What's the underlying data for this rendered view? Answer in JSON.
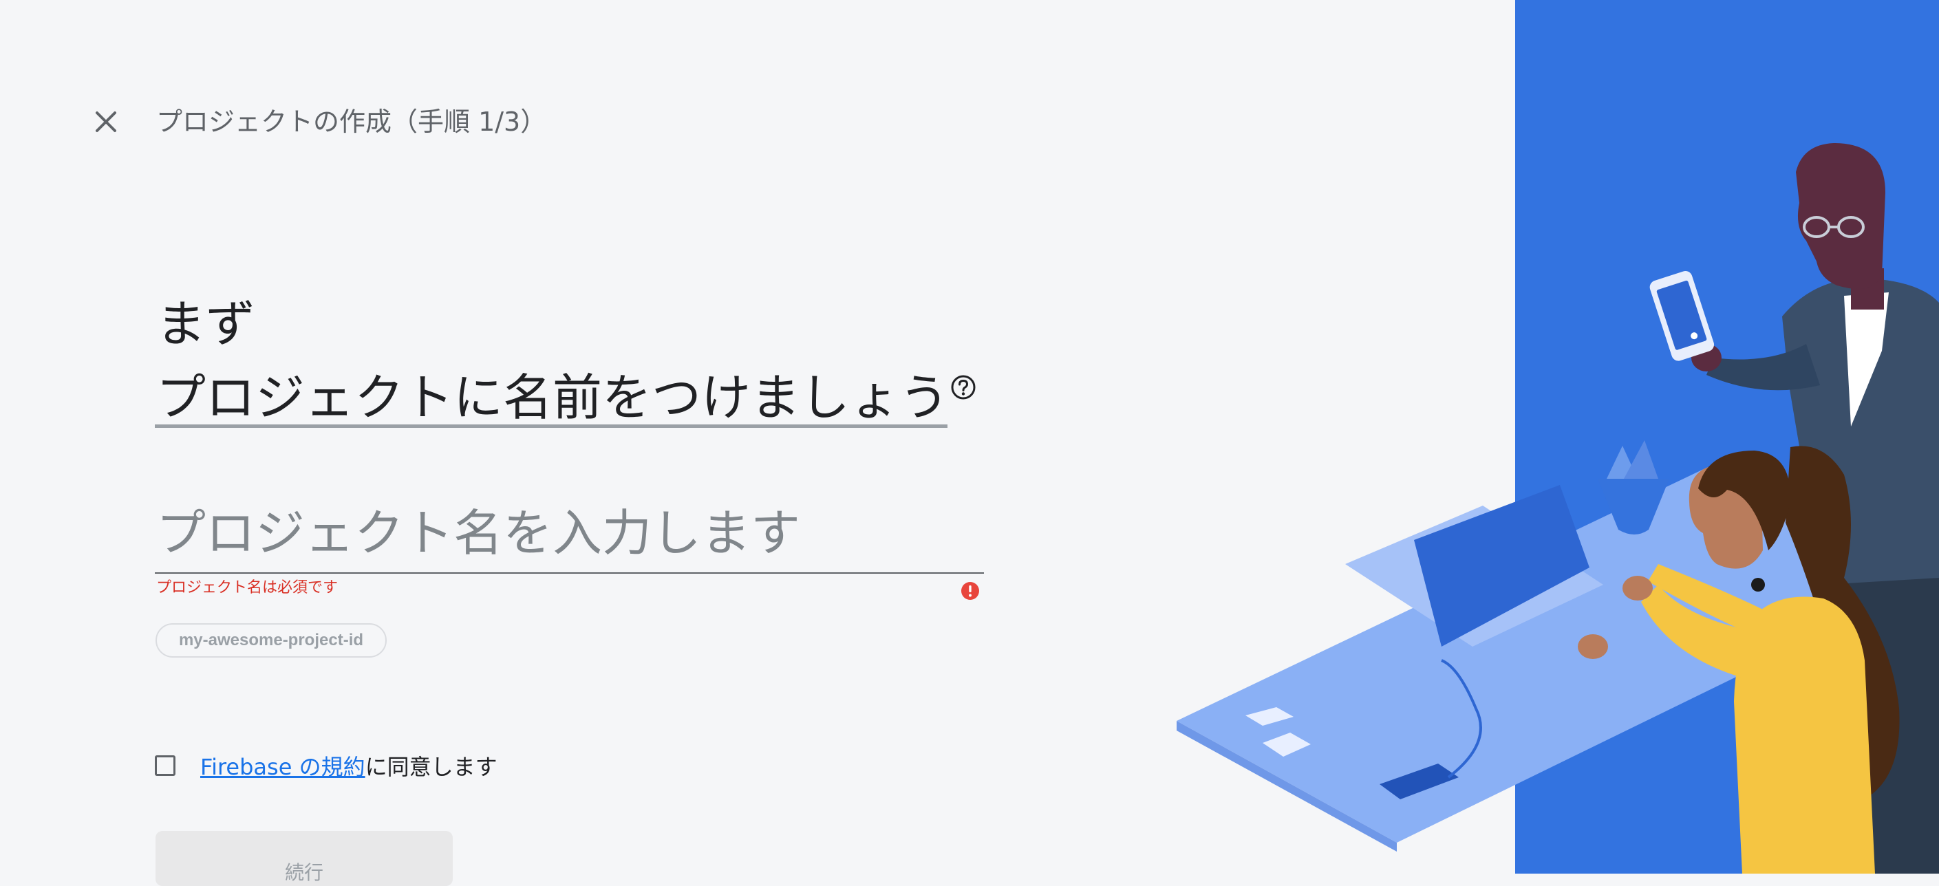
{
  "header": {
    "close_icon": "close-icon",
    "step_title": "プロジェクトの作成（手順 1/3）"
  },
  "main": {
    "heading_line1": "まず",
    "heading_line2": "プロジェクトに名前をつけましょう",
    "help_icon": "help-circle-icon"
  },
  "project_name": {
    "value": "",
    "placeholder": "プロジェクト名を入力します",
    "error": "プロジェクト名は必須です",
    "error_icon": "error-icon"
  },
  "project_id_chip": "my-awesome-project-id",
  "terms": {
    "checked": false,
    "link": "Firebase の規約",
    "suffix": "に同意します"
  },
  "continue_button": "続行",
  "colors": {
    "accent_blue": "#3373e0",
    "link": "#1a73e8",
    "error": "#d93025",
    "background": "#f5f6f8"
  }
}
